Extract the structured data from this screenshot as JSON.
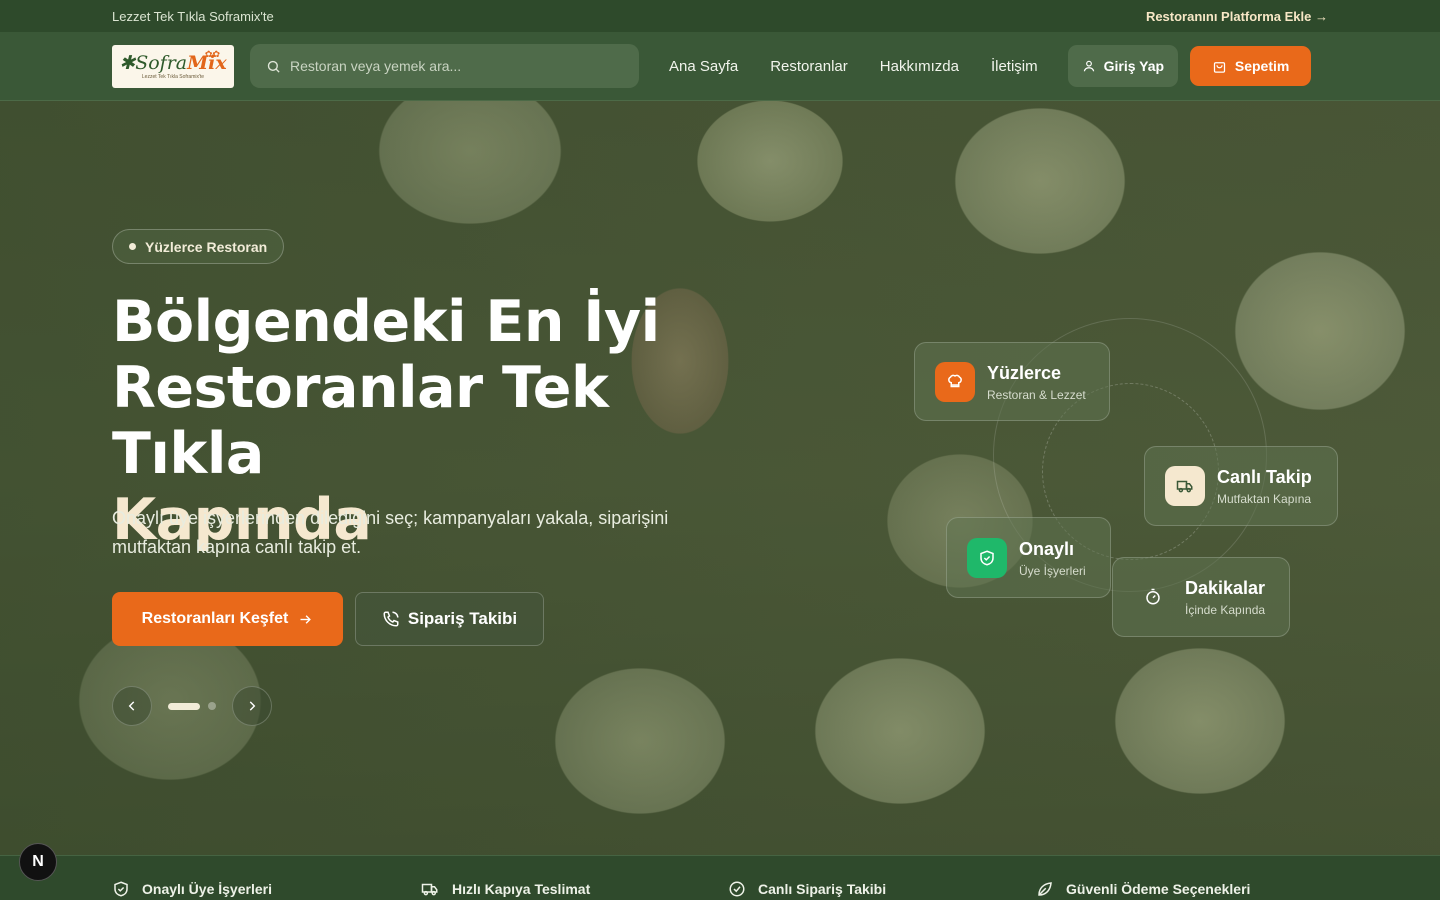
{
  "topbar": {
    "promo": "Lezzet Tek Tıkla Soframix'te",
    "add_restaurant": "Restoranını Platforma Ekle →"
  },
  "header": {
    "logo": {
      "word_a": "Sofra",
      "word_b": "Mix",
      "tagline": "Lezzet Tek Tıkla Soframix'te"
    },
    "search": {
      "placeholder": "Restoran veya yemek ara...",
      "icon": "search-icon"
    },
    "nav": [
      "Ana Sayfa",
      "Restoranlar",
      "Hakkımızda",
      "İletişim"
    ],
    "login_label": "Giriş Yap",
    "cart_label": "Sepetim"
  },
  "hero": {
    "badge": "Yüzlerce Restoran",
    "title_line1": "Bölgendeki En İyi",
    "title_line2": "Restoranlar Tek Tıkla",
    "title_line3": "Kapında",
    "subtitle": "Onaylı üye işyerlerinden dilediğini seç; kampanyaları yakala, siparişini mutfaktan kapına canlı takip et.",
    "primary_button": "Restoranları Keşfet",
    "secondary_button": "Sipariş Takibi",
    "slide_count": 2,
    "active_slide": 1
  },
  "feature_cards": [
    {
      "title": "Yüzlerce",
      "subtitle": "Restoran & Lezzet",
      "icon": "chef-hat-icon",
      "color": "#e9691a"
    },
    {
      "title": "Canlı Takip",
      "subtitle": "Mutfaktan Kapına",
      "icon": "truck-icon",
      "color": "#f5e8cf"
    },
    {
      "title": "Onaylı",
      "subtitle": "Üye İşyerleri",
      "icon": "shield-check-icon",
      "color": "#1fb86a"
    },
    {
      "title": "Dakikalar",
      "subtitle": "İçinde Kapında",
      "icon": "timer-icon",
      "color": "transparent"
    }
  ],
  "features_strip": [
    {
      "label": "Onaylı Üye İşyerleri",
      "icon": "shield-check-icon"
    },
    {
      "label": "Hızlı Kapıya Teslimat",
      "icon": "truck-icon"
    },
    {
      "label": "Canlı Sipariş Takibi",
      "icon": "check-circle-icon"
    },
    {
      "label": "Güvenli Ödeme Seçenekleri",
      "icon": "leaf-icon"
    }
  ],
  "dev_badge": "N",
  "colors": {
    "accent": "#e9691a",
    "header_bg": "#3a5837",
    "topbar_bg": "#2e4a2b",
    "cream": "#f5e8cf"
  }
}
